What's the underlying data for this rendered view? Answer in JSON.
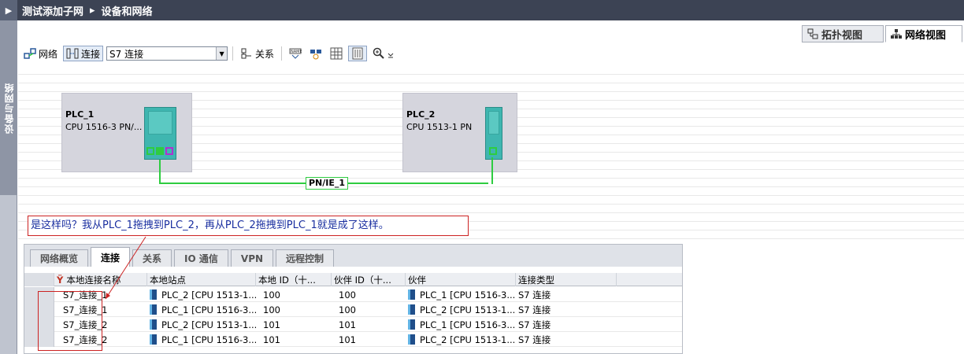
{
  "title": {
    "project": "测试添加子网",
    "separator": "▸",
    "page": "设备和网络"
  },
  "sidebar": {
    "label": "设备与网络"
  },
  "views": {
    "topology": "拓扑视图",
    "network": "网络视图"
  },
  "toolbar": {
    "network_label": "网络",
    "connect_label": "连接",
    "connection_type": "S7 连接",
    "relation_label": "关系"
  },
  "devices": [
    {
      "name": "PLC_1",
      "type": "CPU 1516-3 PN/..."
    },
    {
      "name": "PLC_2",
      "type": "CPU 1513-1 PN"
    }
  ],
  "subnet": {
    "label": "PN/IE_1",
    "color": "#2ecc40"
  },
  "annotation": {
    "text": "是这样吗？我从PLC_1拖拽到PLC_2，再从PLC_2拖拽到PLC_1就是成了这样。"
  },
  "panel": {
    "tabs": [
      "网络概览",
      "连接",
      "关系",
      "IO 通信",
      "VPN",
      "远程控制"
    ],
    "active_tab": "连接",
    "columns": [
      "本地连接名称",
      "本地站点",
      "本地 ID（十...",
      "伙伴 ID（十...",
      "伙伴",
      "连接类型"
    ],
    "rows": [
      {
        "name": "S7_连接_1",
        "local_station": "PLC_2 [CPU 1513-1...",
        "local_id": "100",
        "partner_id": "100",
        "partner": "PLC_1 [CPU 1516-3...",
        "type": "S7 连接"
      },
      {
        "name": "S7_连接_1",
        "local_station": "PLC_1 [CPU 1516-3...",
        "local_id": "100",
        "partner_id": "100",
        "partner": "PLC_2 [CPU 1513-1...",
        "type": "S7 连接"
      },
      {
        "name": "S7_连接_2",
        "local_station": "PLC_2 [CPU 1513-1...",
        "local_id": "101",
        "partner_id": "101",
        "partner": "PLC_1 [CPU 1516-3...",
        "type": "S7 连接"
      },
      {
        "name": "S7_连接_2",
        "local_station": "PLC_1 [CPU 1516-3...",
        "local_id": "101",
        "partner_id": "101",
        "partner": "PLC_2 [CPU 1513-1...",
        "type": "S7 连接"
      }
    ]
  },
  "colors": {
    "titlebar": "#3c4354",
    "annotation_border": "#cc2222",
    "annotation_text": "#1a2fa0",
    "cpu": "#3fb6b0"
  }
}
